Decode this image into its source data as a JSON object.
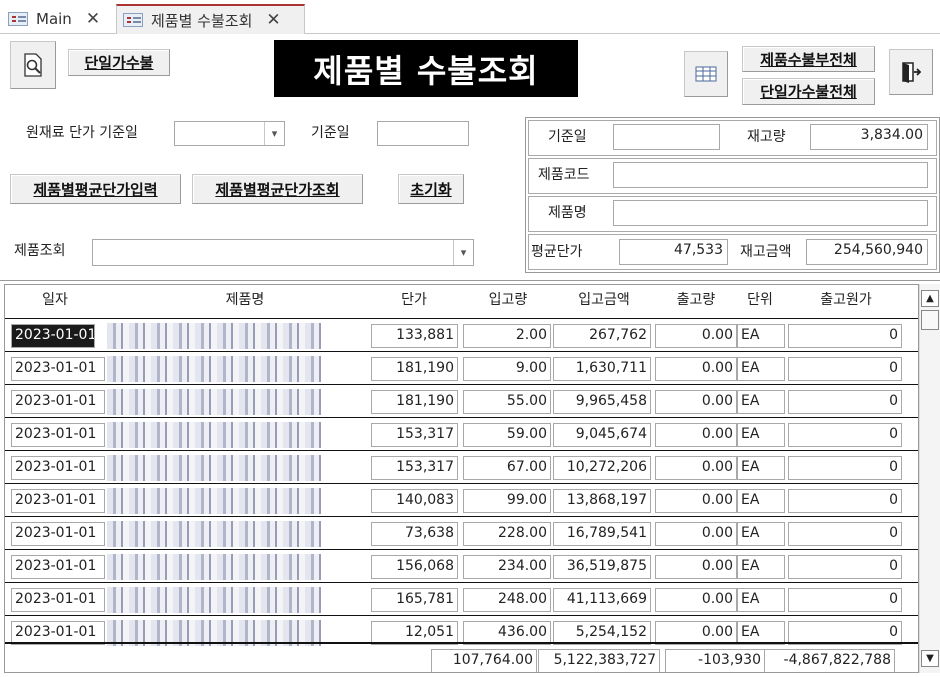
{
  "tabs": [
    {
      "label": "Main",
      "icon": "form-icon"
    },
    {
      "label": "제품별 수불조회",
      "icon": "form-icon"
    }
  ],
  "toolbar": {
    "preview_icon": "print-preview-icon",
    "unit_flow_button": "단일가수불",
    "form_title": "제품별 수불조회",
    "table_icon": "datasheet-icon",
    "product_all_button": "제품수불부전체",
    "unit_all_button": "단일가수불전체",
    "exit_icon": "exit-door-icon"
  },
  "filters": {
    "material_price_date_label": "원재료 단가 기준일",
    "material_price_date_value": "",
    "base_date_label": "기준일",
    "base_date_value": "",
    "avg_price_entry_button": "제품별평균단가입력",
    "avg_price_query_button": "제품별평균단가조회",
    "reset_button": "초기화",
    "product_search_label": "제품조회",
    "product_search_value": ""
  },
  "info": {
    "base_date_label": "기준일",
    "base_date_value": "",
    "stock_qty_label": "재고량",
    "stock_qty_value": "3,834.00",
    "product_code_label": "제품코드",
    "product_code_value": "",
    "product_name_label": "제품명",
    "product_name_value": "",
    "avg_price_label": "평균단가",
    "avg_price_value": "47,533",
    "stock_amount_label": "재고금액",
    "stock_amount_value": "254,560,940"
  },
  "grid": {
    "headers": [
      "일자",
      "제품명",
      "단가",
      "입고량",
      "입고금액",
      "출고량",
      "단위",
      "출고원가"
    ],
    "rows": [
      {
        "date": "2023-01-01",
        "name": "",
        "price": "133,881",
        "in_qty": "2.00",
        "in_amt": "267,762",
        "out_qty": "0.00",
        "unit": "EA",
        "out_cost": "0"
      },
      {
        "date": "2023-01-01",
        "name": "",
        "price": "181,190",
        "in_qty": "9.00",
        "in_amt": "1,630,711",
        "out_qty": "0.00",
        "unit": "EA",
        "out_cost": "0"
      },
      {
        "date": "2023-01-01",
        "name": "",
        "price": "181,190",
        "in_qty": "55.00",
        "in_amt": "9,965,458",
        "out_qty": "0.00",
        "unit": "EA",
        "out_cost": "0"
      },
      {
        "date": "2023-01-01",
        "name": "",
        "price": "153,317",
        "in_qty": "59.00",
        "in_amt": "9,045,674",
        "out_qty": "0.00",
        "unit": "EA",
        "out_cost": "0"
      },
      {
        "date": "2023-01-01",
        "name": "",
        "price": "153,317",
        "in_qty": "67.00",
        "in_amt": "10,272,206",
        "out_qty": "0.00",
        "unit": "EA",
        "out_cost": "0"
      },
      {
        "date": "2023-01-01",
        "name": "",
        "price": "140,083",
        "in_qty": "99.00",
        "in_amt": "13,868,197",
        "out_qty": "0.00",
        "unit": "EA",
        "out_cost": "0"
      },
      {
        "date": "2023-01-01",
        "name": "",
        "price": "73,638",
        "in_qty": "228.00",
        "in_amt": "16,789,541",
        "out_qty": "0.00",
        "unit": "EA",
        "out_cost": "0"
      },
      {
        "date": "2023-01-01",
        "name": "",
        "price": "156,068",
        "in_qty": "234.00",
        "in_amt": "36,519,875",
        "out_qty": "0.00",
        "unit": "EA",
        "out_cost": "0"
      },
      {
        "date": "2023-01-01",
        "name": "",
        "price": "165,781",
        "in_qty": "248.00",
        "in_amt": "41,113,669",
        "out_qty": "0.00",
        "unit": "EA",
        "out_cost": "0"
      },
      {
        "date": "2023-01-01",
        "name": "",
        "price": "12,051",
        "in_qty": "436.00",
        "in_amt": "5,254,152",
        "out_qty": "0.00",
        "unit": "EA",
        "out_cost": "0"
      }
    ],
    "totals": {
      "in_qty": "107,764.00",
      "in_amt": "5,122,383,727",
      "out_qty": "-103,930",
      "out_cost": "-4,867,822,788"
    }
  }
}
